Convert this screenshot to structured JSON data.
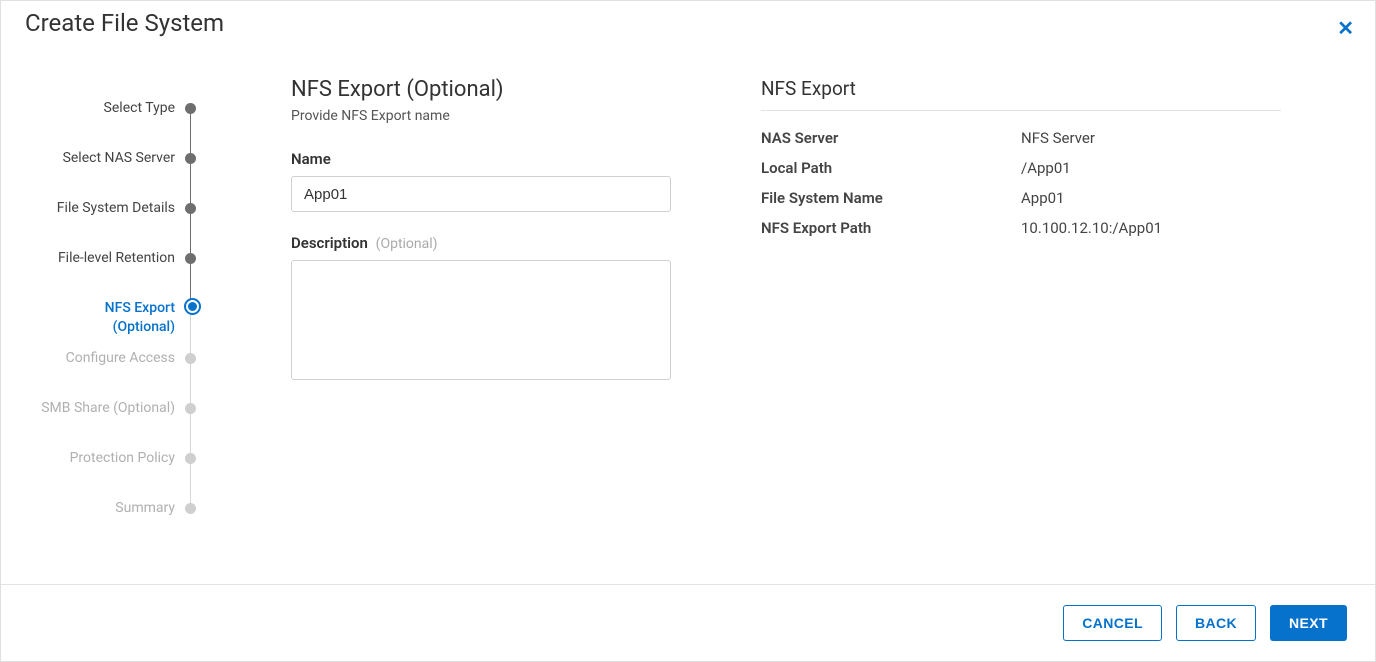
{
  "title": "Create File System",
  "steps": [
    {
      "label": "Select Type",
      "state": "done"
    },
    {
      "label": "Select NAS Server",
      "state": "done"
    },
    {
      "label": "File System Details",
      "state": "done"
    },
    {
      "label": "File-level Retention",
      "state": "done"
    },
    {
      "label": "NFS Export\n(Optional)",
      "state": "current"
    },
    {
      "label": "Configure Access",
      "state": "future"
    },
    {
      "label": "SMB Share (Optional)",
      "state": "future"
    },
    {
      "label": "Protection Policy",
      "state": "future"
    },
    {
      "label": "Summary",
      "state": "future"
    }
  ],
  "form": {
    "section_title": "NFS Export (Optional)",
    "section_subtitle": "Provide NFS Export name",
    "name_label": "Name",
    "name_value": "App01",
    "description_label": "Description",
    "description_optional_hint": "(Optional)",
    "description_value": ""
  },
  "summary": {
    "heading": "NFS Export",
    "rows": [
      {
        "key": "NAS Server",
        "value": "NFS Server"
      },
      {
        "key": "Local Path",
        "value": "/App01"
      },
      {
        "key": "File System Name",
        "value": "App01"
      },
      {
        "key": "NFS Export Path",
        "value": "10.100.12.10:/App01"
      }
    ]
  },
  "footer": {
    "cancel": "CANCEL",
    "back": "BACK",
    "next": "NEXT"
  }
}
